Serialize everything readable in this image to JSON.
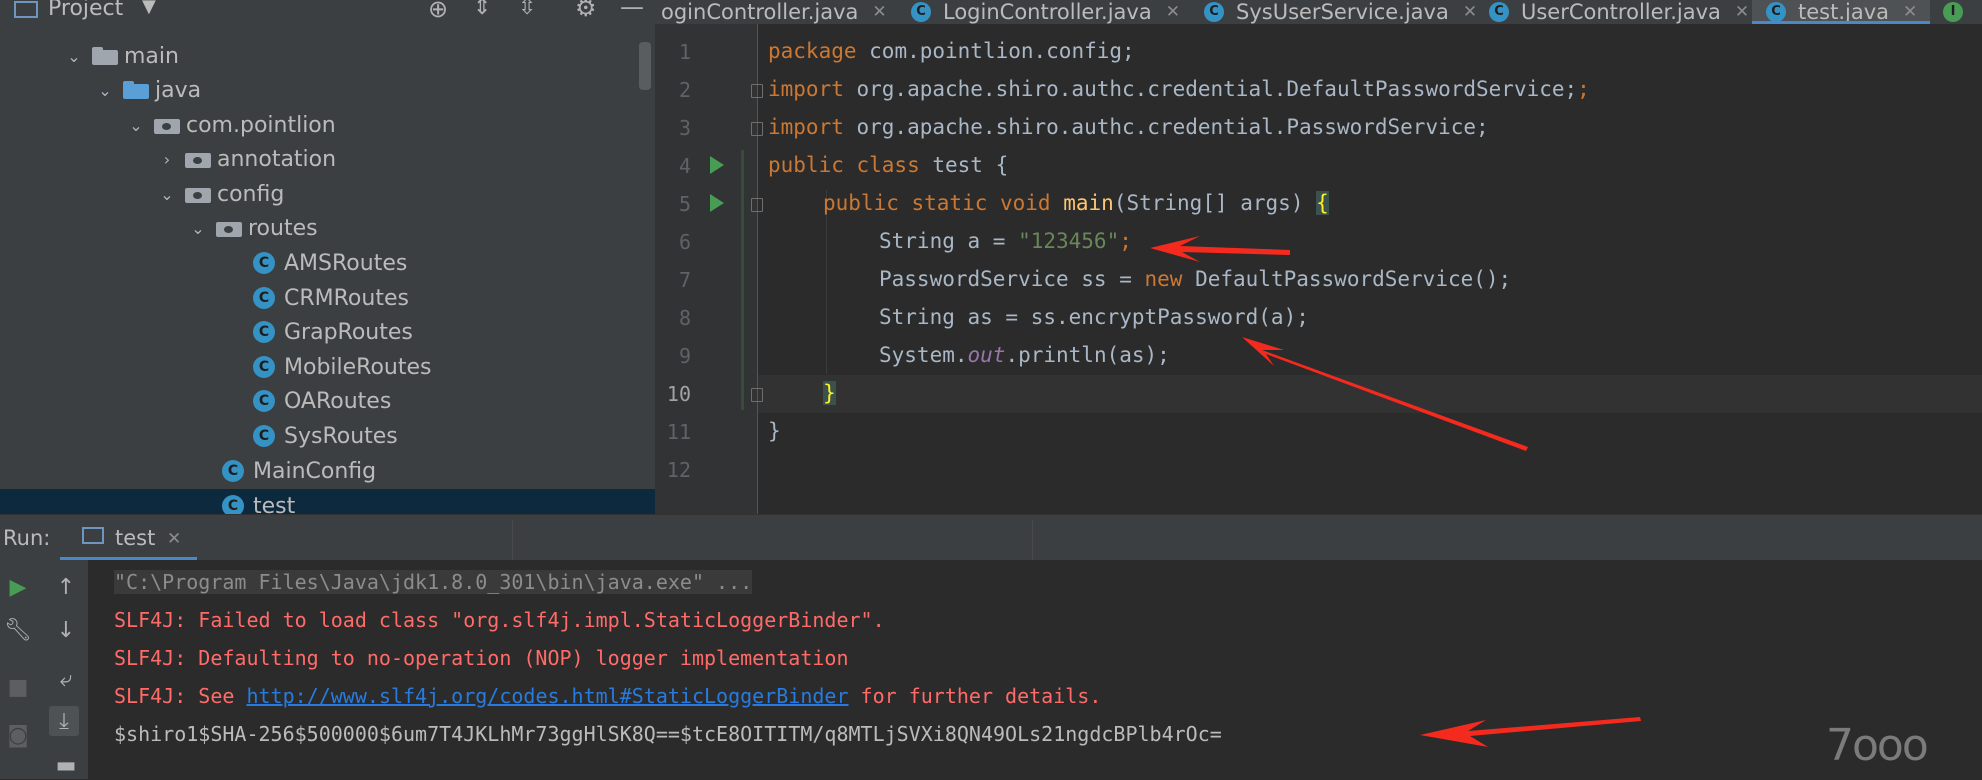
{
  "project_panel": {
    "title": "Project",
    "tree": [
      {
        "label": "main",
        "kind": "folder",
        "expanded": true
      },
      {
        "label": "java",
        "kind": "source-folder",
        "expanded": true
      },
      {
        "label": "com.pointlion",
        "kind": "package",
        "expanded": true
      },
      {
        "label": "annotation",
        "kind": "package",
        "expanded": false
      },
      {
        "label": "config",
        "kind": "package",
        "expanded": true
      },
      {
        "label": "routes",
        "kind": "package",
        "expanded": true
      },
      {
        "label": "AMSRoutes",
        "kind": "class"
      },
      {
        "label": "CRMRoutes",
        "kind": "class"
      },
      {
        "label": "GrapRoutes",
        "kind": "class"
      },
      {
        "label": "MobileRoutes",
        "kind": "class"
      },
      {
        "label": "OARoutes",
        "kind": "class"
      },
      {
        "label": "SysRoutes",
        "kind": "class"
      },
      {
        "label": "MainConfig",
        "kind": "class"
      },
      {
        "label": "test",
        "kind": "class-runnable",
        "selected": true
      }
    ]
  },
  "editor_tabs": [
    {
      "label": "oginController.java",
      "active": false
    },
    {
      "label": "LoginController.java",
      "active": false
    },
    {
      "label": "SysUserService.java",
      "active": false
    },
    {
      "label": "UserController.java",
      "active": false
    },
    {
      "label": "test.java",
      "active": true
    }
  ],
  "editor": {
    "line_numbers": [
      "1",
      "2",
      "3",
      "4",
      "5",
      "6",
      "7",
      "8",
      "9",
      "10",
      "11",
      "12"
    ],
    "current_line": "10",
    "code": {
      "l1_kw": "package",
      "l1_rest": " com.pointlion.config;",
      "l2_kw": "import",
      "l2_rest": " org.apache.shiro.authc.credential.DefaultPasswordService;",
      "l3_kw": "import",
      "l3_rest": " org.apache.shiro.authc.credential.PasswordService;",
      "l4_kw": "public class",
      "l4_rest": " test {",
      "l5_kw": "public static void",
      "l5_fn": "main",
      "l5_rest": "(String[] args) ",
      "l5_brace": "{",
      "l6_pre": "String a = ",
      "l6_str": "\"123456\"",
      "l6_post": ";",
      "l7_pre": "PasswordService ss = ",
      "l7_kw": "new",
      "l7_post": " DefaultPasswordService();",
      "l8": "String as = ss.encryptPassword(a);",
      "l9_pre": "System.",
      "l9_static": "out",
      "l9_post": ".println(as);",
      "l10": "}",
      "l11": "}"
    }
  },
  "run_panel": {
    "label": "Run:",
    "tab_label": "test",
    "console": {
      "cmd": "\"C:\\Program Files\\Java\\jdk1.8.0_301\\bin\\java.exe\" ...",
      "err1": "SLF4J: Failed to load class \"org.slf4j.impl.StaticLoggerBinder\".",
      "err2": "SLF4J: Defaulting to no-operation (NOP) logger implementation",
      "err3_pre": "SLF4J: See ",
      "err3_link": "http://www.slf4j.org/codes.html#StaticLoggerBinder",
      "err3_post": " for further details.",
      "output": "$shiro1$SHA-256$500000$6um7T4JKLhMr73ggHlSK8Q==$tcE8OITITM/q8MTLjSVXi8QN49OLs21ngdcBPlb4rOc="
    }
  },
  "watermark": "7ooo",
  "colors": {
    "keyword": "#cc7832",
    "string": "#6a8759",
    "function": "#ffc66d",
    "error": "#ff6b68",
    "link": "#287bde",
    "annotation_arrow": "#f52a1e"
  }
}
